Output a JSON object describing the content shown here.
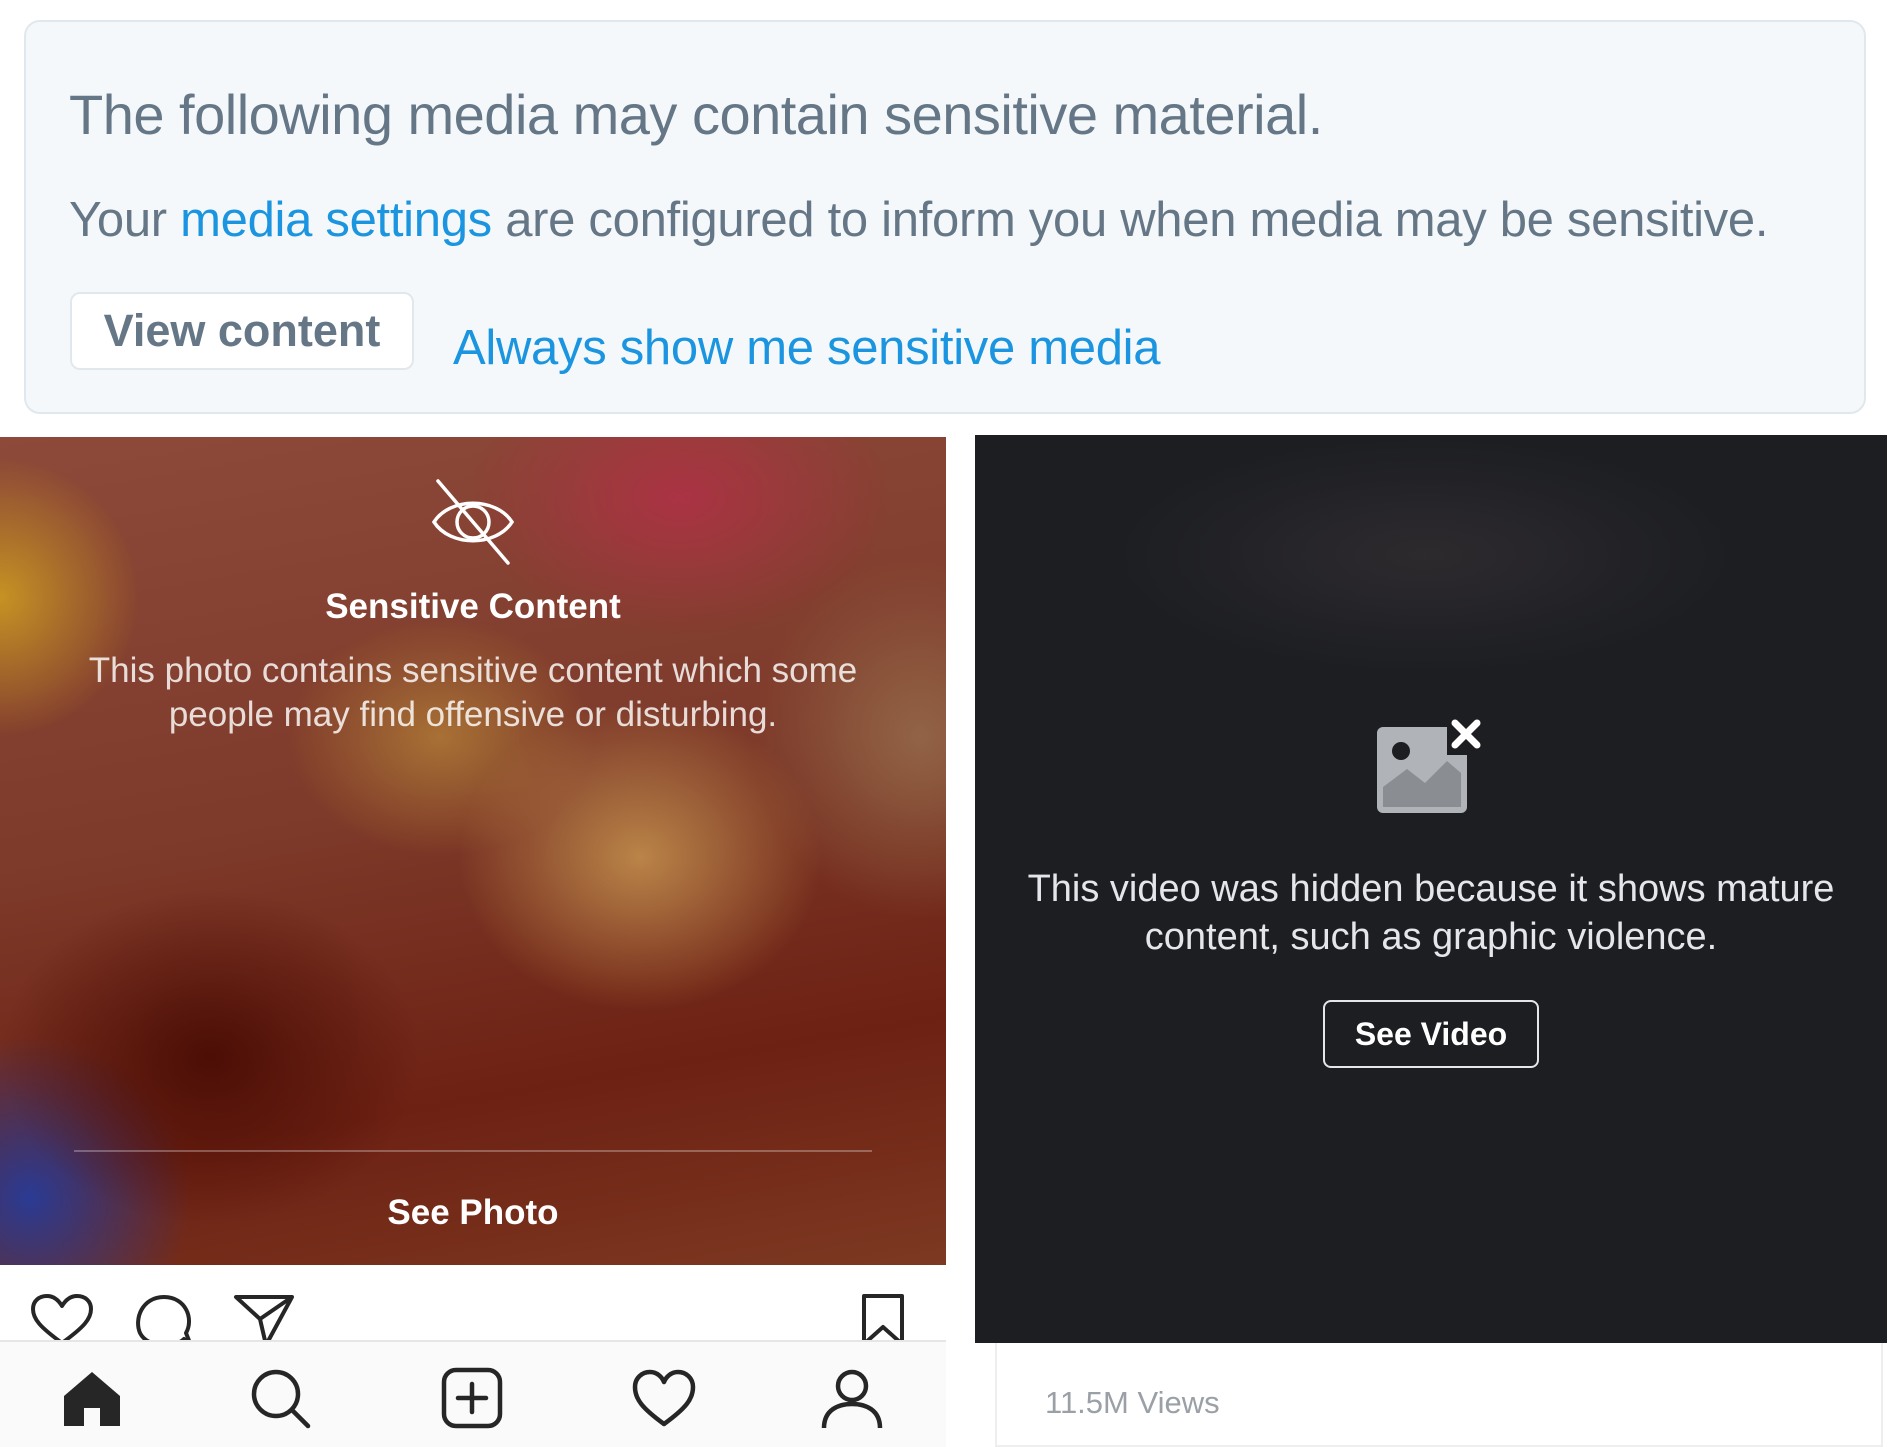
{
  "twitter_notice": {
    "title": "The following media may contain sensitive material.",
    "line_prefix": "Your ",
    "settings_link": "media settings",
    "line_suffix": " are configured to inform you when media may be sensitive.",
    "view_button": "View content",
    "always_link": "Always show me sensitive media",
    "colors": {
      "link": "#1b95e0",
      "text": "#657786",
      "background": "#f5f8fa"
    }
  },
  "instagram": {
    "overlay_icon": "eye-slash-icon",
    "title": "Sensitive Content",
    "description": "This photo contains sensitive content which some people may find offensive or disturbing.",
    "see_photo": "See Photo",
    "actions": [
      "heart-icon",
      "comment-icon",
      "share-icon",
      "bookmark-icon"
    ],
    "tabs": [
      "home-icon",
      "search-icon",
      "add-post-icon",
      "activity-heart-icon",
      "profile-icon"
    ]
  },
  "facebook_video": {
    "overlay_icon": "hidden-image-icon",
    "message": "This video was hidden because it shows mature content, such as graphic violence.",
    "see_video": "See Video",
    "views": "11.5M Views"
  }
}
